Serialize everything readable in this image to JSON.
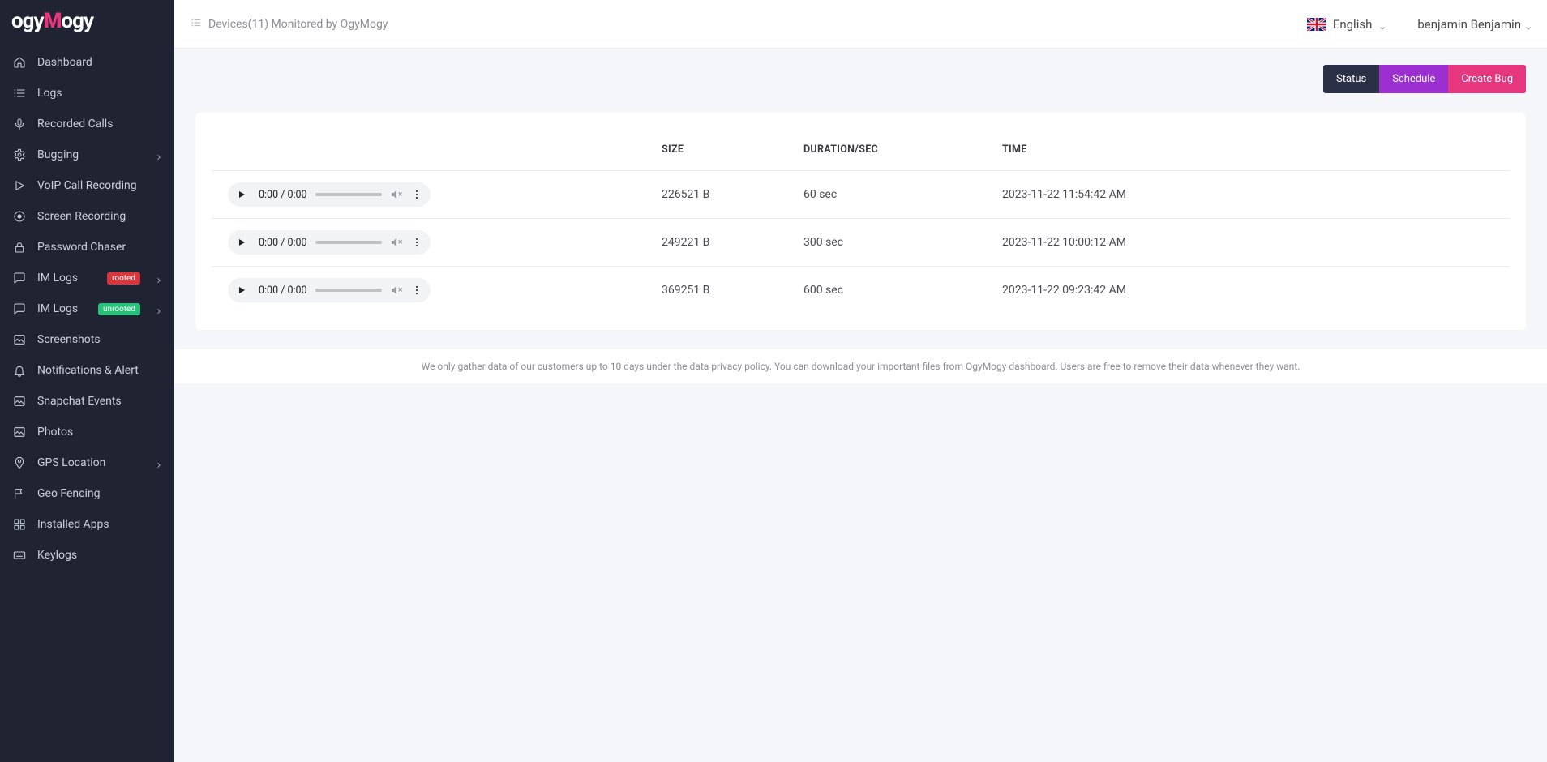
{
  "logo": {
    "pre": "ogy",
    "accent": "M",
    "post": "ogy"
  },
  "header": {
    "breadcrumb": "Devices(11) Monitored by OgyMogy",
    "language": "English",
    "user": "benjamin Benjamin"
  },
  "sidebar": {
    "items": [
      {
        "label": "Dashboard",
        "icon": "home",
        "badge": null,
        "expandable": false
      },
      {
        "label": "Logs",
        "icon": "list",
        "badge": null,
        "expandable": false
      },
      {
        "label": "Recorded Calls",
        "icon": "mic",
        "badge": null,
        "expandable": false
      },
      {
        "label": "Bugging",
        "icon": "gear",
        "badge": null,
        "expandable": true
      },
      {
        "label": "VoIP Call Recording",
        "icon": "play",
        "badge": null,
        "expandable": false
      },
      {
        "label": "Screen Recording",
        "icon": "record",
        "badge": null,
        "expandable": false
      },
      {
        "label": "Password Chaser",
        "icon": "lock",
        "badge": null,
        "expandable": false
      },
      {
        "label": "IM Logs",
        "icon": "chat",
        "badge": "rooted",
        "expandable": true
      },
      {
        "label": "IM Logs",
        "icon": "chat",
        "badge": "unrooted",
        "expandable": true
      },
      {
        "label": "Screenshots",
        "icon": "image",
        "badge": null,
        "expandable": false
      },
      {
        "label": "Notifications & Alert",
        "icon": "bell",
        "badge": null,
        "expandable": false
      },
      {
        "label": "Snapchat Events",
        "icon": "image",
        "badge": null,
        "expandable": false
      },
      {
        "label": "Photos",
        "icon": "image",
        "badge": null,
        "expandable": false
      },
      {
        "label": "GPS Location",
        "icon": "pin",
        "badge": null,
        "expandable": true
      },
      {
        "label": "Geo Fencing",
        "icon": "flag",
        "badge": null,
        "expandable": false
      },
      {
        "label": "Installed Apps",
        "icon": "grid",
        "badge": null,
        "expandable": false
      },
      {
        "label": "Keylogs",
        "icon": "keyboard",
        "badge": null,
        "expandable": false
      }
    ]
  },
  "actions": {
    "status": "Status",
    "schedule": "Schedule",
    "create": "Create Bug"
  },
  "table": {
    "headers": {
      "size": "SIZE",
      "duration": "DURATION/SEC",
      "time": "TIME"
    },
    "audio_time": "0:00 / 0:00",
    "rows": [
      {
        "size": "226521 B",
        "duration": "60 sec",
        "time": "2023-11-22 11:54:42 AM"
      },
      {
        "size": "249221 B",
        "duration": "300 sec",
        "time": "2023-11-22 10:00:12 AM"
      },
      {
        "size": "369251 B",
        "duration": "600 sec",
        "time": "2023-11-22 09:23:42 AM"
      }
    ]
  },
  "footer": "We only gather data of our customers up to 10 days under the data privacy policy. You can download your important files from OgyMogy dashboard. Users are free to remove their data whenever they want."
}
